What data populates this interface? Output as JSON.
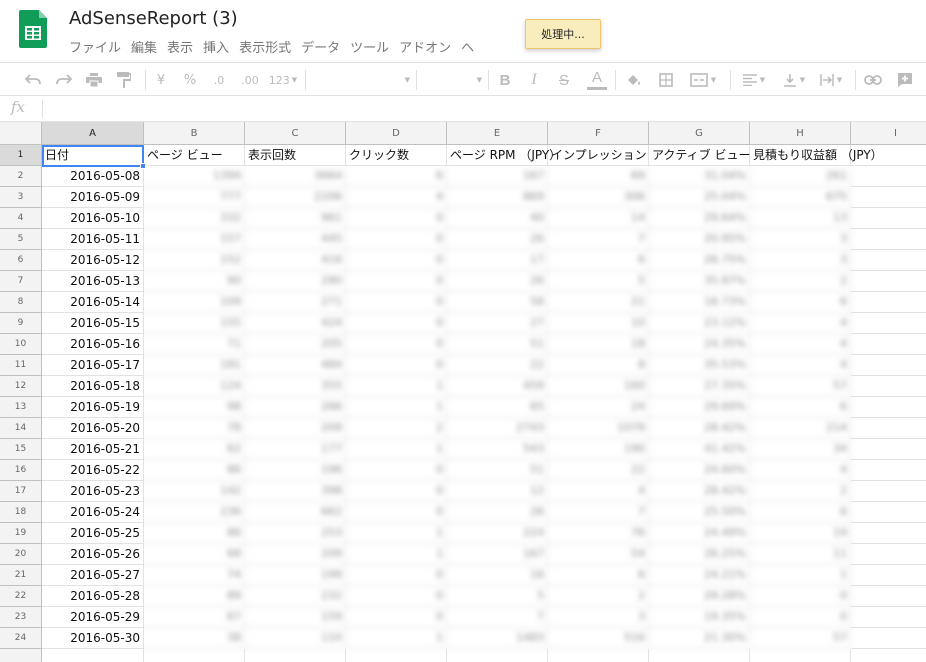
{
  "app": {
    "title": "AdSenseReport (3)",
    "status_toast": "処理中..."
  },
  "menu": [
    "ファイル",
    "編集",
    "表示",
    "挿入",
    "表示形式",
    "データ",
    "ツール",
    "アドオン",
    "ヘ"
  ],
  "toolbar": {
    "currency": "¥",
    "percent": "%",
    "decimal_decrease": ".0",
    "decimal_increase": ".00",
    "more_formats": "123",
    "bold": "B",
    "italic": "I",
    "strike": "S",
    "text_color": "A",
    "icons": [
      "undo-icon",
      "redo-icon",
      "print-icon",
      "paint-format-icon",
      "fill-color-icon",
      "borders-icon",
      "merge-icon",
      "align-icon",
      "valign-icon",
      "text-wrap-icon",
      "link-icon",
      "insert-comment-icon"
    ]
  },
  "formula_bar": {
    "fx": "fx",
    "value": ""
  },
  "columns": [
    "A",
    "B",
    "C",
    "D",
    "E",
    "F",
    "G",
    "H",
    "I"
  ],
  "active_cell": "A1",
  "header_row": [
    "日付",
    "ページ ビュー",
    "表示回数",
    "クリック数",
    "ページ RPM （JPY）",
    "インプレッション",
    "アクティブ ビュー",
    "見積もり収益額 （JPY）",
    ""
  ],
  "rows": [
    {
      "n": "2",
      "date": "2016-05-08",
      "v": [
        "1394",
        "3664",
        "6",
        "167",
        "69",
        "31.04%",
        "261"
      ]
    },
    {
      "n": "3",
      "date": "2016-05-09",
      "v": [
        "777",
        "2206",
        "4",
        "869",
        "306",
        "25.04%",
        "675"
      ]
    },
    {
      "n": "4",
      "date": "2016-05-10",
      "v": [
        "332",
        "961",
        "0",
        "40",
        "14",
        "29.64%",
        "13"
      ]
    },
    {
      "n": "5",
      "date": "2016-05-11",
      "v": [
        "157",
        "445",
        "0",
        "26",
        "7",
        "20.95%",
        "3"
      ]
    },
    {
      "n": "6",
      "date": "2016-05-12",
      "v": [
        "152",
        "416",
        "0",
        "17",
        "6",
        "26.75%",
        "3"
      ]
    },
    {
      "n": "7",
      "date": "2016-05-13",
      "v": [
        "90",
        "290",
        "0",
        "26",
        "5",
        "35.87%",
        "2"
      ]
    },
    {
      "n": "8",
      "date": "2016-05-14",
      "v": [
        "109",
        "271",
        "0",
        "58",
        "21",
        "16.73%",
        "6"
      ]
    },
    {
      "n": "9",
      "date": "2016-05-15",
      "v": [
        "155",
        "424",
        "0",
        "27",
        "10",
        "23.12%",
        "4"
      ]
    },
    {
      "n": "10",
      "date": "2016-05-16",
      "v": [
        "71",
        "205",
        "0",
        "51",
        "18",
        "24.35%",
        "4"
      ]
    },
    {
      "n": "11",
      "date": "2016-05-17",
      "v": [
        "181",
        "484",
        "0",
        "22",
        "8",
        "35.53%",
        "4"
      ]
    },
    {
      "n": "12",
      "date": "2016-05-18",
      "v": [
        "124",
        "355",
        "1",
        "459",
        "160",
        "27.35%",
        "57"
      ]
    },
    {
      "n": "13",
      "date": "2016-05-19",
      "v": [
        "98",
        "266",
        "1",
        "65",
        "24",
        "29.69%",
        "6"
      ]
    },
    {
      "n": "14",
      "date": "2016-05-20",
      "v": [
        "78",
        "209",
        "2",
        "2743",
        "1079",
        "28.42%",
        "214"
      ]
    },
    {
      "n": "15",
      "date": "2016-05-21",
      "v": [
        "62",
        "177",
        "1",
        "543",
        "190",
        "41.42%",
        "34"
      ]
    },
    {
      "n": "16",
      "date": "2016-05-22",
      "v": [
        "86",
        "196",
        "0",
        "51",
        "22",
        "24.60%",
        "4"
      ]
    },
    {
      "n": "17",
      "date": "2016-05-23",
      "v": [
        "142",
        "398",
        "0",
        "12",
        "4",
        "28.42%",
        "2"
      ]
    },
    {
      "n": "18",
      "date": "2016-05-24",
      "v": [
        "236",
        "662",
        "0",
        "26",
        "7",
        "25.50%",
        "6"
      ]
    },
    {
      "n": "19",
      "date": "2016-05-25",
      "v": [
        "86",
        "253",
        "1",
        "224",
        "76",
        "24.49%",
        "19"
      ]
    },
    {
      "n": "20",
      "date": "2016-05-26",
      "v": [
        "68",
        "209",
        "1",
        "167",
        "54",
        "26.25%",
        "11"
      ]
    },
    {
      "n": "21",
      "date": "2016-05-27",
      "v": [
        "74",
        "199",
        "0",
        "16",
        "6",
        "24.21%",
        "1"
      ]
    },
    {
      "n": "22",
      "date": "2016-05-28",
      "v": [
        "89",
        "232",
        "0",
        "5",
        "2",
        "29.28%",
        "0"
      ]
    },
    {
      "n": "23",
      "date": "2016-05-29",
      "v": [
        "67",
        "159",
        "0",
        "7",
        "3",
        "19.35%",
        "0"
      ]
    },
    {
      "n": "24",
      "date": "2016-05-30",
      "v": [
        "38",
        "110",
        "1",
        "1483",
        "516",
        "21.30%",
        "57"
      ]
    }
  ]
}
